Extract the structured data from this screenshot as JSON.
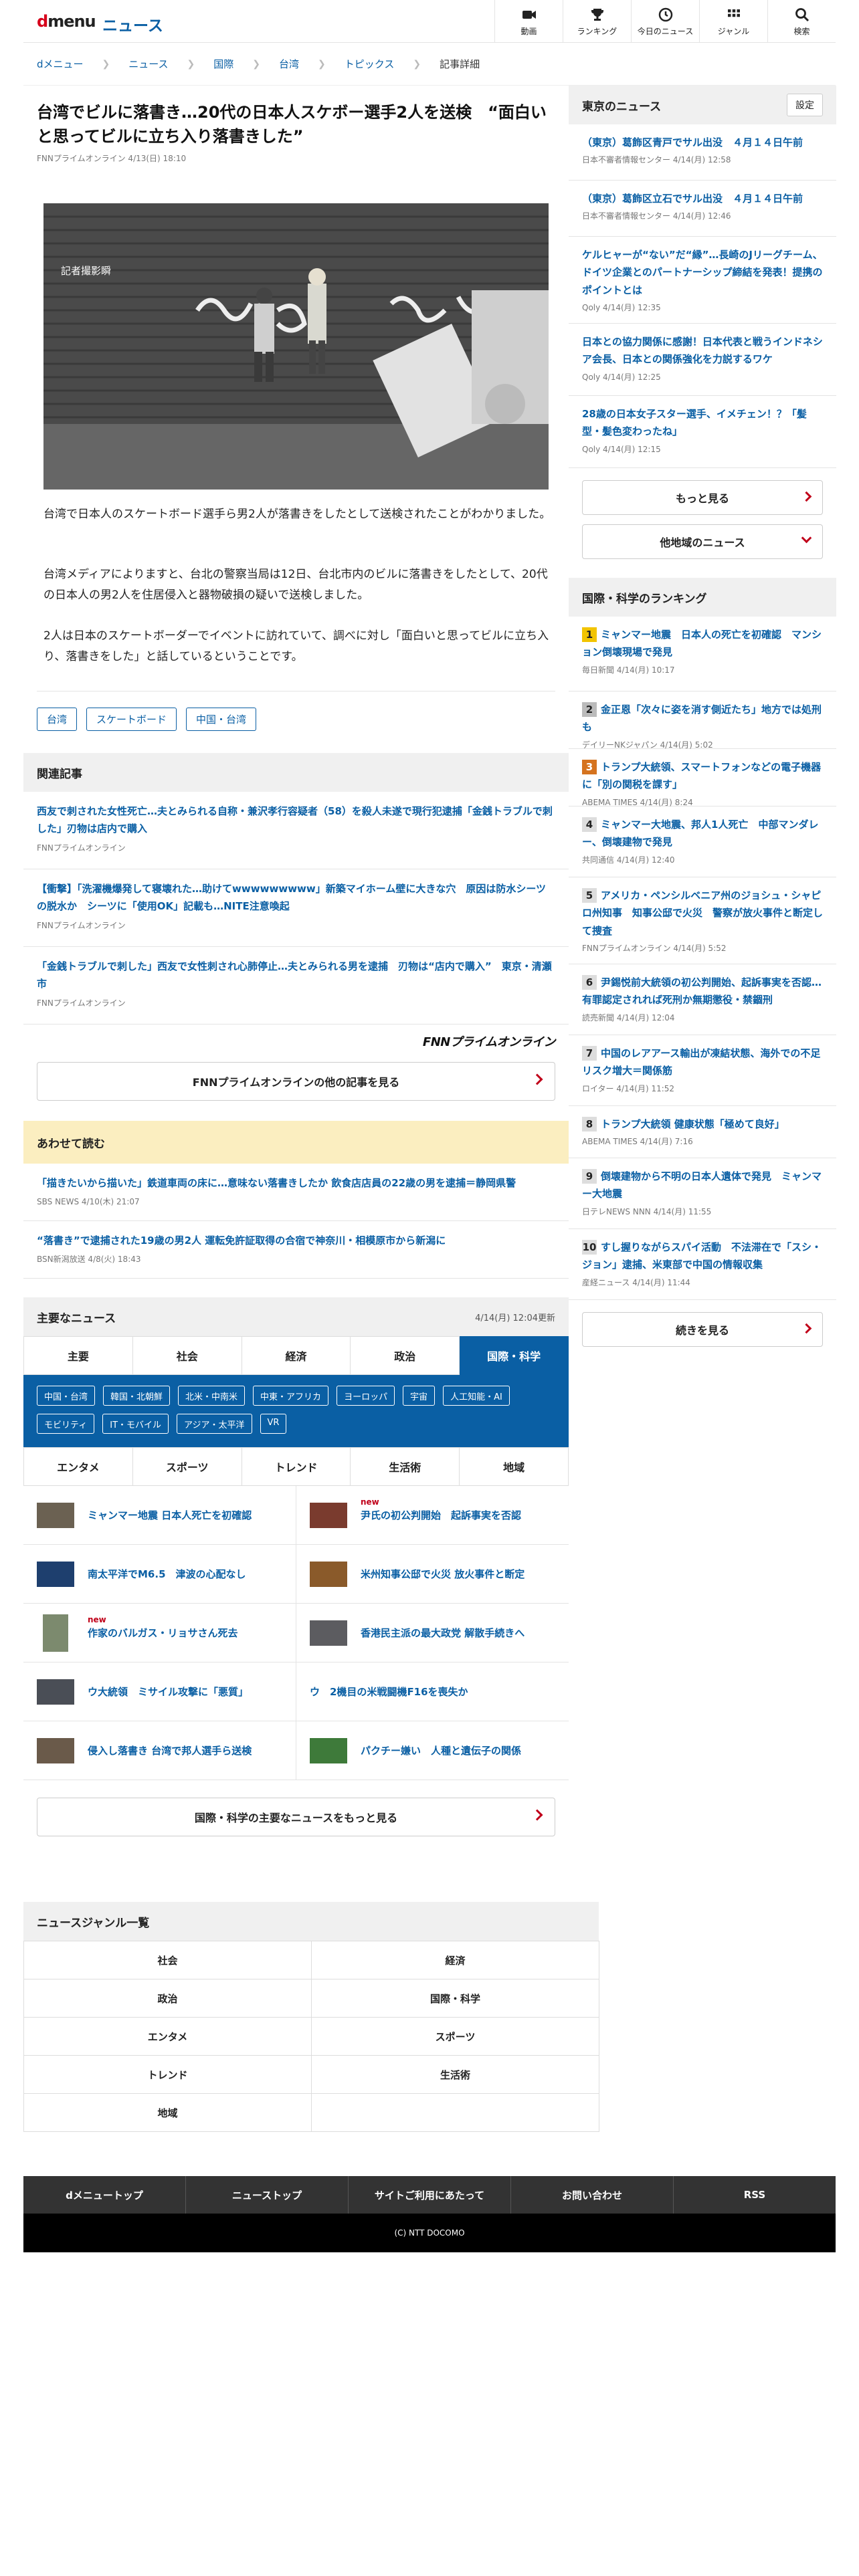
{
  "header": {
    "logo_d": "d",
    "logo_menu": "menu",
    "section": "ニュース",
    "nav": [
      {
        "label": "動画",
        "icon": "video-icon"
      },
      {
        "label": "ランキング",
        "icon": "trophy-icon"
      },
      {
        "label": "今日のニュース",
        "icon": "clock-icon"
      },
      {
        "label": "ジャンル",
        "icon": "grid-icon"
      },
      {
        "label": "検索",
        "icon": "search-icon"
      }
    ]
  },
  "breadcrumb": [
    "dメニュー",
    "ニュース",
    "国際",
    "台湾",
    "トピックス",
    "記事詳細"
  ],
  "article": {
    "title": "台湾でビルに落書き…20代の日本人スケボー選手2人を送検　“面白いと思ってビルに立ち入り落書きした”",
    "meta": "FNNプライムオンライン 4/13(日) 18:10",
    "image_caption": "記者撮影瞬",
    "paragraphs": [
      "台湾で日本人のスケートボード選手ら男2人が落書きをしたとして送検されたことがわかりました。",
      "台湾メディアによりますと、台北の警察当局は12日、台北市内のビルに落書きをしたとして、20代の日本人の男2人を住居侵入と器物破損の疑いで送検しました。",
      "2人は日本のスケートボーダーでイベントに訪れていて、調べに対し「面白いと思ってビルに立ち入り、落書きをした」と話しているということです。"
    ],
    "tags": [
      "台湾",
      "スケートボード",
      "中国・台湾"
    ]
  },
  "related": {
    "heading": "関連記事",
    "items": [
      {
        "title": "西友で刺された女性死亡…夫とみられる自称・兼沢孝行容疑者（58）を殺人未遂で現行犯逮捕「金銭トラブルで刺した」刃物は店内で購入",
        "src": "FNNプライムオンライン"
      },
      {
        "title": "【衝撃】「洗濯機爆発して寝壊れた…助けてwwwwwwwww」新築マイホーム壁に大きな穴　原因は防水シーツの脱水か　シーツに「使用OK」記載も…NITE注意喚起",
        "src": "FNNプライムオンライン"
      },
      {
        "title": "「金銭トラブルで刺した」西友で女性刺され心肺停止…夫とみられる男を逮捕　刃物は“店内で購入”　東京・清瀬市",
        "src": "FNNプライムオンライン"
      }
    ],
    "publisher_logo": "FNNプライムオンライン",
    "more_label": "FNNプライムオンラインの他の記事を見る"
  },
  "also_read": {
    "heading": "あわせて読む",
    "items": [
      {
        "title": "「描きたいから描いた」鉄道車両の床に…意味ない落書きしたか 飲食店店員の22歳の男を逮捕＝静岡県警",
        "src": "SBS NEWS 4/10(木) 21:07"
      },
      {
        "title": "“落書き”で逮捕された19歳の男2人 運転免許証取得の合宿で神奈川・相模原市から新潟に",
        "src": "BSN新潟放送 4/8(火) 18:43"
      }
    ]
  },
  "major": {
    "heading": "主要なニュース",
    "updated": "4/14(月) 12:04更新",
    "tabs_row1": [
      "主要",
      "社会",
      "経済",
      "政治",
      "国際・科学"
    ],
    "active_tab": "国際・科学",
    "subcats": [
      "中国・台湾",
      "韓国・北朝鮮",
      "北米・中南米",
      "中東・アフリカ",
      "ヨーロッパ",
      "宇宙",
      "人工知能・AI",
      "モビリティ",
      "IT・モバイル",
      "アジア・太平洋",
      "VR"
    ],
    "tabs_row2": [
      "エンタメ",
      "スポーツ",
      "トレンド",
      "生活術",
      "地域"
    ],
    "news": [
      {
        "title": "ミャンマー地震 日本人死亡を初確認",
        "new": ""
      },
      {
        "title": "尹氏の初公判開始　起訴事実を否認",
        "new": "new"
      },
      {
        "title": "南太平洋でM6.5　津波の心配なし",
        "new": ""
      },
      {
        "title": "米州知事公邸で火災 放火事件と断定",
        "new": ""
      },
      {
        "title": "作家のバルガス・リョサさん死去",
        "new": "new"
      },
      {
        "title": "香港民主派の最大政党 解散手続きへ",
        "new": ""
      },
      {
        "title": "ウ大統領　ミサイル攻撃に「悪質」",
        "new": ""
      },
      {
        "title": "ウ　2機目の米戦闘機F16を喪失か",
        "new": ""
      },
      {
        "title": "侵入し落書き 台湾で邦人選手ら送検",
        "new": ""
      },
      {
        "title": "パクチー嫌い　人種と遺伝子の関係",
        "new": ""
      }
    ],
    "more_label": "国際・科学の主要なニュースをもっと見る"
  },
  "genre": {
    "heading": "ニュースジャンル一覧",
    "items": [
      "社会",
      "経済",
      "政治",
      "国際・科学",
      "エンタメ",
      "スポーツ",
      "トレンド",
      "生活術",
      "地域",
      ""
    ]
  },
  "footer": {
    "links": [
      "dメニュートップ",
      "ニューストップ",
      "サイトご利用にあたって",
      "お問い合わせ",
      "RSS"
    ],
    "copyright": "(C) NTT DOCOMO"
  },
  "sidebar": {
    "tokyo": {
      "heading": "東京のニュース",
      "setting": "設定",
      "items": [
        {
          "title": "（東京）葛飾区青戸でサル出没　４月１４日午前",
          "src": "日本不審者情報センター 4/14(月) 12:58"
        },
        {
          "title": "（東京）葛飾区立石でサル出没　４月１４日午前",
          "src": "日本不審者情報センター 4/14(月) 12:46"
        },
        {
          "title": "ケルヒャーが“ない”だ“縁”…長崎のJリーグチーム、ドイツ企業とのパートナーシップ締結を発表！提携のポイントとは",
          "src": "Qoly 4/14(月) 12:35"
        },
        {
          "title": "日本との協力関係に感謝！日本代表と戦うインドネシア会長、日本との関係強化を力説するワケ",
          "src": "Qoly 4/14(月) 12:25"
        },
        {
          "title": "28歳の日本女子スター選手、イメチェン！？「髪型・髪色変わったね」",
          "src": "Qoly 4/14(月) 12:15"
        }
      ],
      "more": "もっと見る",
      "other": "他地域のニュース"
    },
    "ranking": {
      "heading": "国際・科学のランキング",
      "items": [
        {
          "rank": "1",
          "title": "ミャンマー地震　日本人の死亡を初確認　マンション倒壊現場で発見",
          "src": "毎日新聞 4/14(月) 10:17"
        },
        {
          "rank": "2",
          "title": "金正恩「次々に姿を消す側近たち」地方では処刑も",
          "src": "デイリーNKジャパン 4/14(月) 5:02"
        },
        {
          "rank": "3",
          "title": "トランプ大統領、スマートフォンなどの電子機器に「別の関税を課す」",
          "src": "ABEMA TIMES 4/14(月) 8:24"
        },
        {
          "rank": "4",
          "title": "ミャンマー大地震、邦人1人死亡　中部マンダレー、倒壊建物で発見",
          "src": "共同通信 4/14(月) 12:40"
        },
        {
          "rank": "5",
          "title": "アメリカ・ペンシルベニア州のジョシュ・シャピロ州知事　知事公邸で火災　警察が放火事件と断定して捜査",
          "src": "FNNプライムオンライン 4/14(月) 5:52"
        },
        {
          "rank": "6",
          "title": "尹錫悦前大統領の初公判開始、起訴事実を否認…有罪認定されれば死刑か無期懲役・禁錮刑",
          "src": "読売新聞 4/14(月) 12:04"
        },
        {
          "rank": "7",
          "title": "中国のレアアース輸出が凍結状態、海外での不足リスク増大＝関係筋",
          "src": "ロイター 4/14(月) 11:52"
        },
        {
          "rank": "8",
          "title": "トランプ大統領 健康状態「極めて良好」",
          "src": "ABEMA TIMES 4/14(月) 7:16"
        },
        {
          "rank": "9",
          "title": "倒壊建物から不明の日本人遺体で発見　ミャンマー大地震",
          "src": "日テレNEWS NNN 4/14(月) 11:55"
        },
        {
          "rank": "10",
          "title": "すし握りながらスパイ活動　不法滞在で「スシ・ジョン」逮捕、米東部で中国の情報収集",
          "src": "産経ニュース 4/14(月) 11:44"
        }
      ],
      "more": "続きを見る"
    }
  }
}
